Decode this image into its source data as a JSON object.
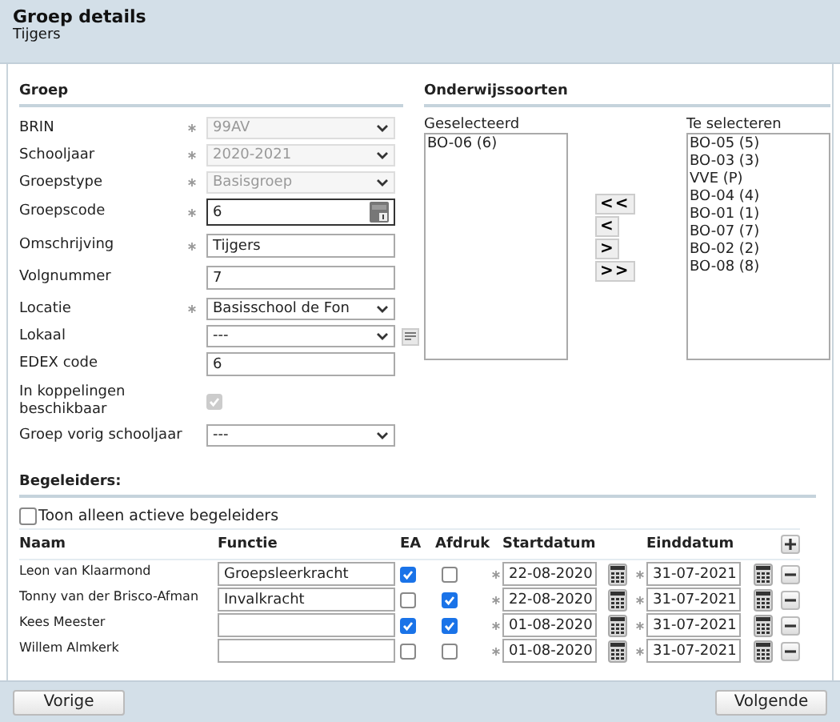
{
  "header": {
    "title": "Groep details",
    "subtitle": "Tijgers"
  },
  "groep": {
    "heading": "Groep",
    "fields": [
      {
        "label": "BRIN",
        "kind": "select",
        "value": "99AV",
        "required": true,
        "disabled": true
      },
      {
        "label": "Schooljaar",
        "kind": "select",
        "value": "2020-2021",
        "required": true,
        "disabled": true
      },
      {
        "label": "Groepstype",
        "kind": "select",
        "value": "Basisgroep",
        "required": true,
        "disabled": true
      },
      {
        "label": "Groepscode",
        "kind": "code",
        "value": "6",
        "required": true,
        "disabled": false
      },
      {
        "label": "Omschrijving",
        "kind": "text",
        "value": "Tijgers",
        "required": true,
        "disabled": false
      },
      {
        "label": "Volgnummer",
        "kind": "text",
        "value": "7",
        "required": false,
        "disabled": false
      },
      {
        "label": "Locatie",
        "kind": "select",
        "value": "Basisschool de Fon",
        "required": true,
        "disabled": false
      },
      {
        "label": "Lokaal",
        "kind": "select-note",
        "value": "---",
        "required": false,
        "disabled": false
      },
      {
        "label": "EDEX code",
        "kind": "text",
        "value": "6",
        "required": false,
        "disabled": false
      },
      {
        "label": "In koppelingen beschikbaar",
        "kind": "checkbox",
        "checked": true,
        "required": false,
        "disabled": true
      },
      {
        "label": "Groep vorig schooljaar",
        "kind": "select",
        "value": "---",
        "required": false,
        "disabled": false
      }
    ]
  },
  "onderwijssoorten": {
    "heading": "Onderwijssoorten",
    "selected_list": {
      "label": "Geselecteerd",
      "items": [
        "BO-06 (6)"
      ]
    },
    "move_buttons": [
      "<<",
      "<",
      ">",
      ">>"
    ],
    "available_list": {
      "label": "Te selecteren",
      "items": [
        "BO-05 (5)",
        "BO-03 (3)",
        "VVE (P)",
        "BO-04 (4)",
        "BO-01 (1)",
        "BO-07 (7)",
        "BO-02 (2)",
        "BO-08 (8)"
      ]
    }
  },
  "begeleiders": {
    "heading": "Begeleiders:",
    "filter": {
      "label": "Toon alleen actieve begeleiders",
      "checked": false
    },
    "columns": [
      {
        "label": "Naam",
        "required": false
      },
      {
        "label": "Functie",
        "required": false
      },
      {
        "label": "EA",
        "required": false
      },
      {
        "label": "Afdruk",
        "required": false
      },
      {
        "label": "Startdatum",
        "required": true
      },
      {
        "label": "Einddatum",
        "required": true
      }
    ],
    "rows": [
      {
        "naam": "Leon van Klaarmond",
        "functie": "Groepsleerkracht",
        "ea": true,
        "afdruk": false,
        "startdatum": "22-08-2020",
        "einddatum": "31-07-2021"
      },
      {
        "naam": "Tonny van der Brisco-Afman",
        "functie": "Invalkracht",
        "ea": false,
        "afdruk": true,
        "startdatum": "22-08-2020",
        "einddatum": "31-07-2021"
      },
      {
        "naam": "Kees Meester",
        "functie": "",
        "ea": true,
        "afdruk": true,
        "startdatum": "01-08-2020",
        "einddatum": "31-07-2021"
      },
      {
        "naam": "Willem Almkerk",
        "functie": "",
        "ea": false,
        "afdruk": false,
        "startdatum": "01-08-2020",
        "einddatum": "31-07-2021"
      }
    ]
  },
  "footer": {
    "buttons": [
      "Vorige",
      "Volgende"
    ]
  }
}
